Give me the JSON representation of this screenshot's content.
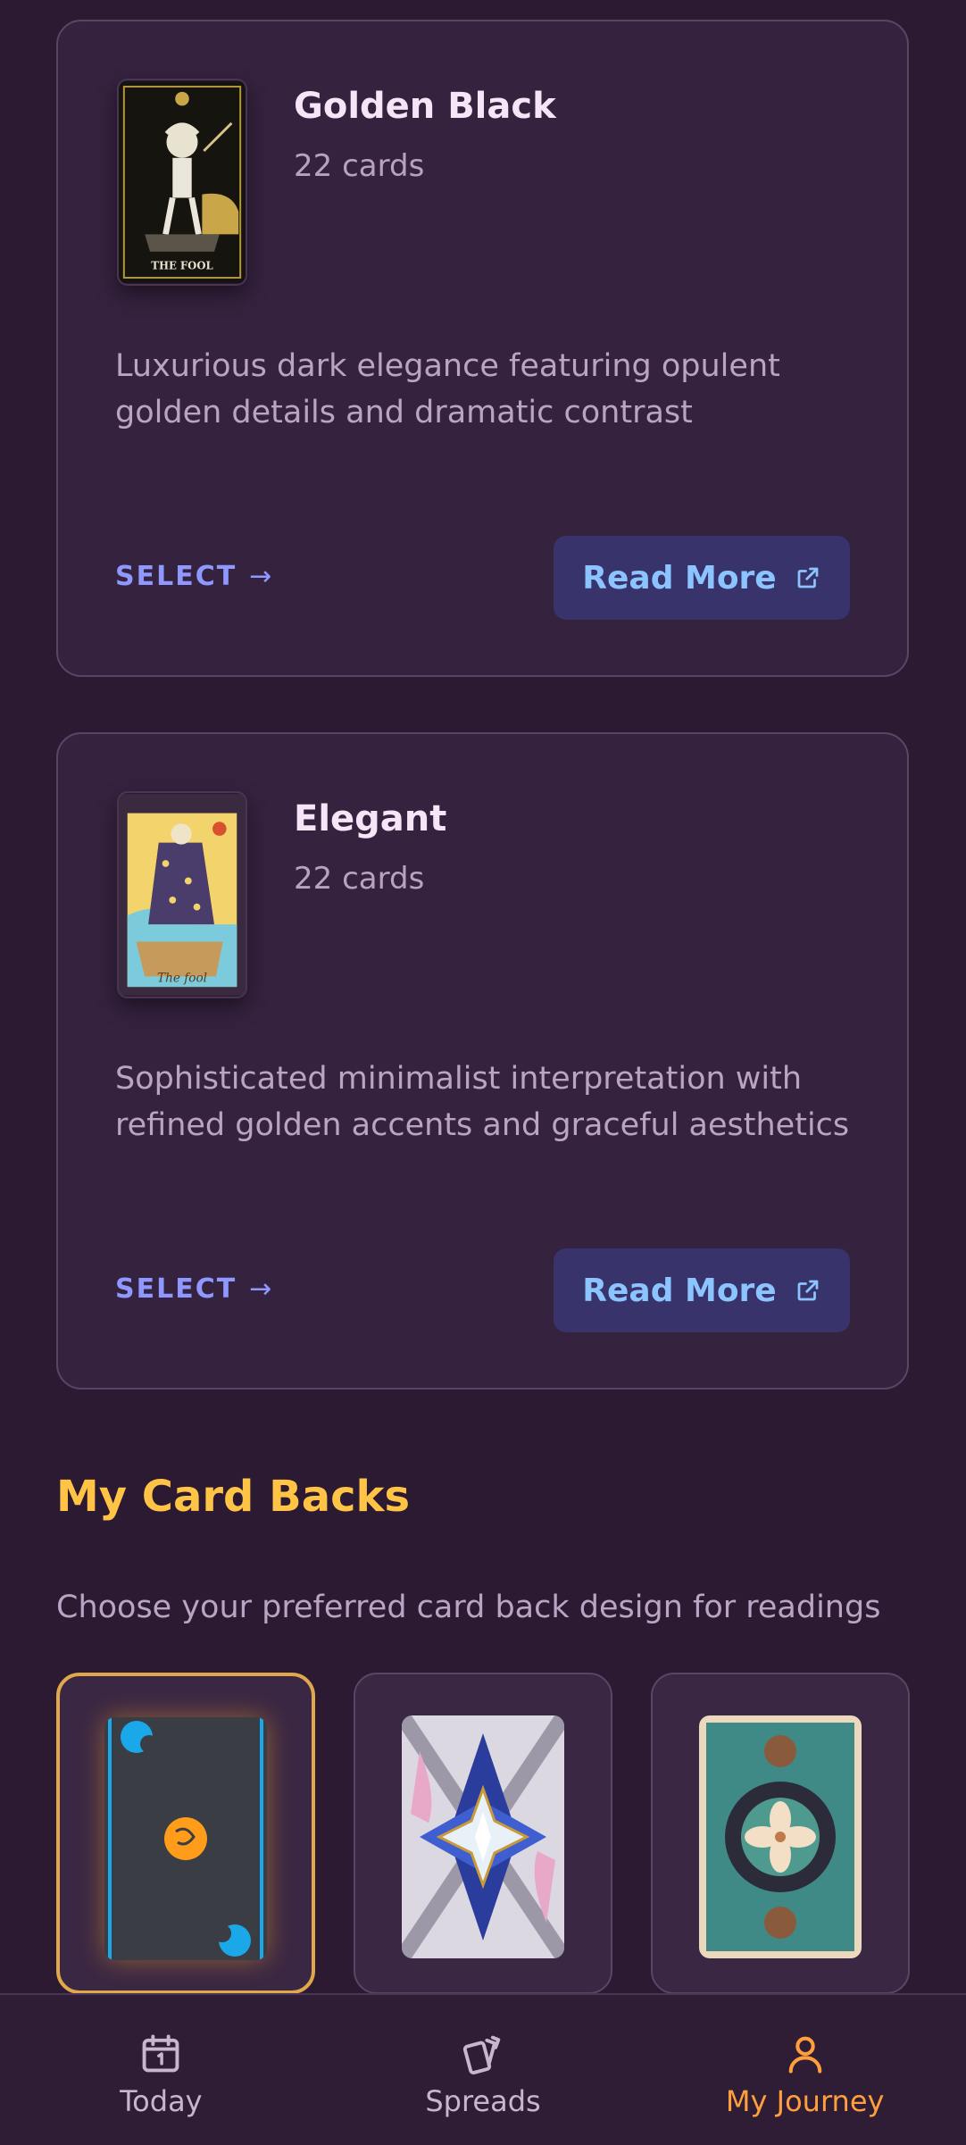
{
  "decks": [
    {
      "title": "Golden Black",
      "count": "22 cards",
      "description": "Luxurious dark elegance featuring opulent golden details and dramatic contrast",
      "thumb_caption": "THE FOOL",
      "select_label": "SELECT",
      "read_more_label": "Read More"
    },
    {
      "title": "Elegant",
      "count": "22 cards",
      "description": "Sophisticated minimalist interpretation with refined golden accents and graceful aesthetics",
      "thumb_caption": "The fool",
      "select_label": "SELECT",
      "read_more_label": "Read More"
    }
  ],
  "card_backs": {
    "title": "My Card Backs",
    "subtitle": "Choose your preferred card back design for readings",
    "selected_index": 0
  },
  "nav": {
    "items": [
      {
        "label": "Today",
        "icon": "calendar-icon",
        "active": false
      },
      {
        "label": "Spreads",
        "icon": "cards-icon",
        "active": false
      },
      {
        "label": "My Journey",
        "icon": "user-icon",
        "active": true
      }
    ]
  },
  "colors": {
    "background": "#2b1a31",
    "accent_gold": "#ffc445",
    "select_blue": "#8f98ff",
    "read_more_blue": "#8cc4ff",
    "nav_active": "#ff9e3d"
  }
}
